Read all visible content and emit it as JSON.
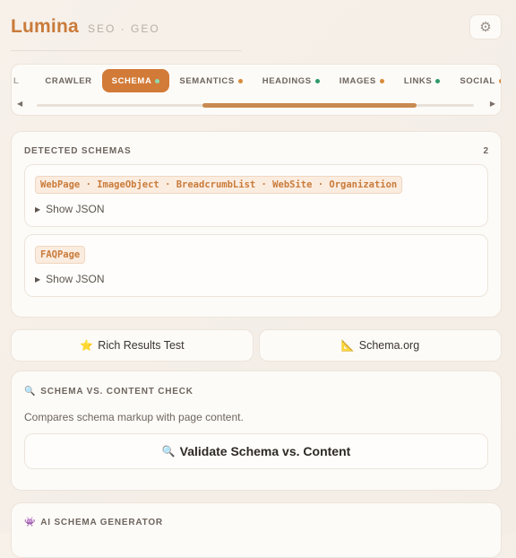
{
  "app": {
    "brand": "Lumina",
    "subtitle": "SEO · GEO",
    "settings_icon": "gear-icon"
  },
  "tabs": [
    {
      "label": "L",
      "dot": null
    },
    {
      "label": "CRAWLER",
      "dot": null
    },
    {
      "label": "SCHEMA",
      "dot": "green",
      "active": true
    },
    {
      "label": "SEMANTICS",
      "dot": "orange"
    },
    {
      "label": "HEADINGS",
      "dot": "green"
    },
    {
      "label": "IMAGES",
      "dot": "orange"
    },
    {
      "label": "LINKS",
      "dot": "green"
    },
    {
      "label": "SOCIAL",
      "dot": "orange"
    }
  ],
  "scroll": {
    "left_arrow": "◀",
    "right_arrow": "▶"
  },
  "schemas": {
    "title": "DETECTED SCHEMAS",
    "count": "2",
    "items": [
      {
        "types": "WebPage · ImageObject · BreadcrumbList · WebSite · Organization",
        "toggle": "Show JSON"
      },
      {
        "types": "FAQPage",
        "toggle": "Show JSON"
      }
    ]
  },
  "links": {
    "rich_results": {
      "icon": "⭐",
      "label": "Rich Results Test"
    },
    "schema_org": {
      "icon": "📐",
      "label": "Schema.org"
    }
  },
  "check": {
    "icon": "🔍",
    "title": "SCHEMA VS. CONTENT CHECK",
    "description": "Compares schema markup with page content.",
    "button_icon": "🔍",
    "button_label": "Validate Schema vs. Content"
  },
  "generator": {
    "icon": "👾",
    "title": "AI SCHEMA GENERATOR"
  },
  "colors": {
    "accent": "#d27a37",
    "brand": "#c97b3a",
    "dot_green": "#2e9a6b",
    "dot_orange": "#d98a3a"
  }
}
